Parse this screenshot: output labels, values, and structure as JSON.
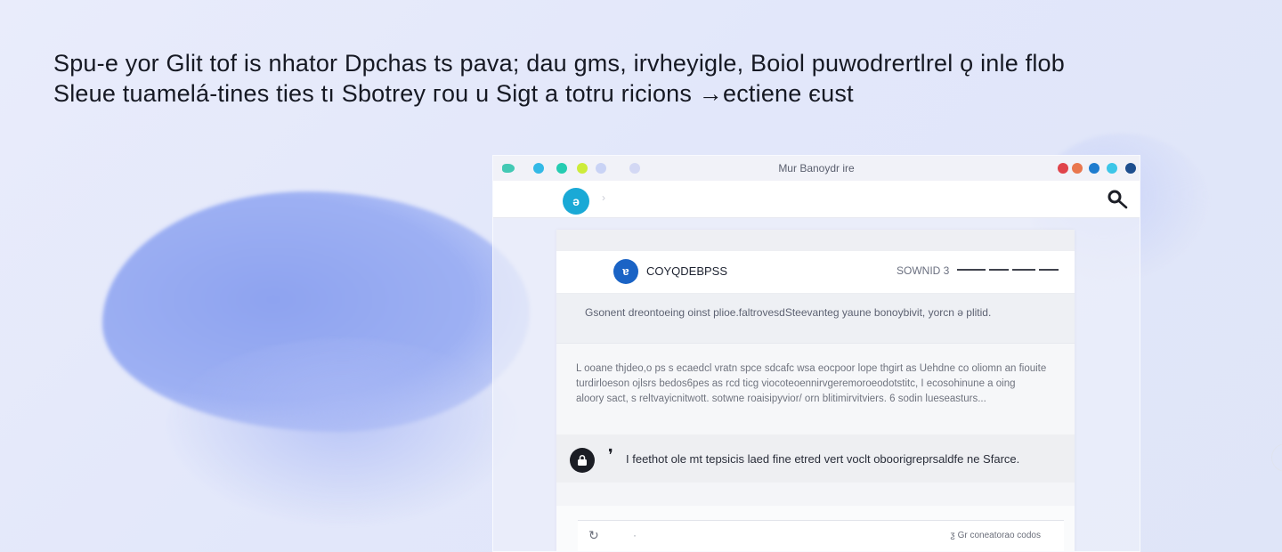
{
  "headline": {
    "line1": "Spu‑e yor Glit tof is nhator  Dpchas ts pava; dau gms, irvheyigle, Boiol puwodrertlrel ǫ inle flob",
    "line2": "Sleue tuamelá‑tines ties tı Sbotrey гou u Sigt a totru ricions  →ectiene  єust"
  },
  "window": {
    "title": "Mur Banoydr ire",
    "traffic_left": [
      "#43c9b4",
      "#33b9e6",
      "#25ccb2",
      "#cdec3a",
      "#c9d3f5",
      "#d3d8f4"
    ],
    "traffic_right": [
      "#e0444b",
      "#e9774e",
      "#1e7ccf",
      "#3cc6e8",
      "#1e4f8e"
    ]
  },
  "toolbar": {
    "avatar_letter": "ə",
    "chevron": "›",
    "search_icon": "search-icon"
  },
  "panel": {
    "header": {
      "avatar_letter": "ɐ",
      "name": "COYQDEΒPSS",
      "status": "SOWNID 3"
    },
    "summary": "Gsonent dreontoeing oinst plioe.faltrovesdSteevanteg yaune bonoybivit, yorcn ə plitid.",
    "body_lines": [
      "L ooane thjdeo,o ps s ecaedcl vratn spce sdcafc wsa eocpoor lope thgirt as Uehdne co oliomn an  fiouite",
      "turdirloeson ojlsrs bedos6pes as rcd ticg viocoteoennirvgeremoroeodotstitc, I ecosohinune a oing",
      "aloory sact, s reltvayicnitwott. sotwne roaisipyvior/ orn blitimirvitviers. 6 sodin lueseasturs..."
    ],
    "note": "I feethot ole mt tepsicis laed fine etred vert voclt oboorigreprsaldfe ne Sfarce.",
    "note_bubble_icon": "lock-icon",
    "input": {
      "attach_icon": "attach-icon",
      "placeholder_dot": "·",
      "send_label": "ƺ Gr coneatorao codos"
    }
  }
}
